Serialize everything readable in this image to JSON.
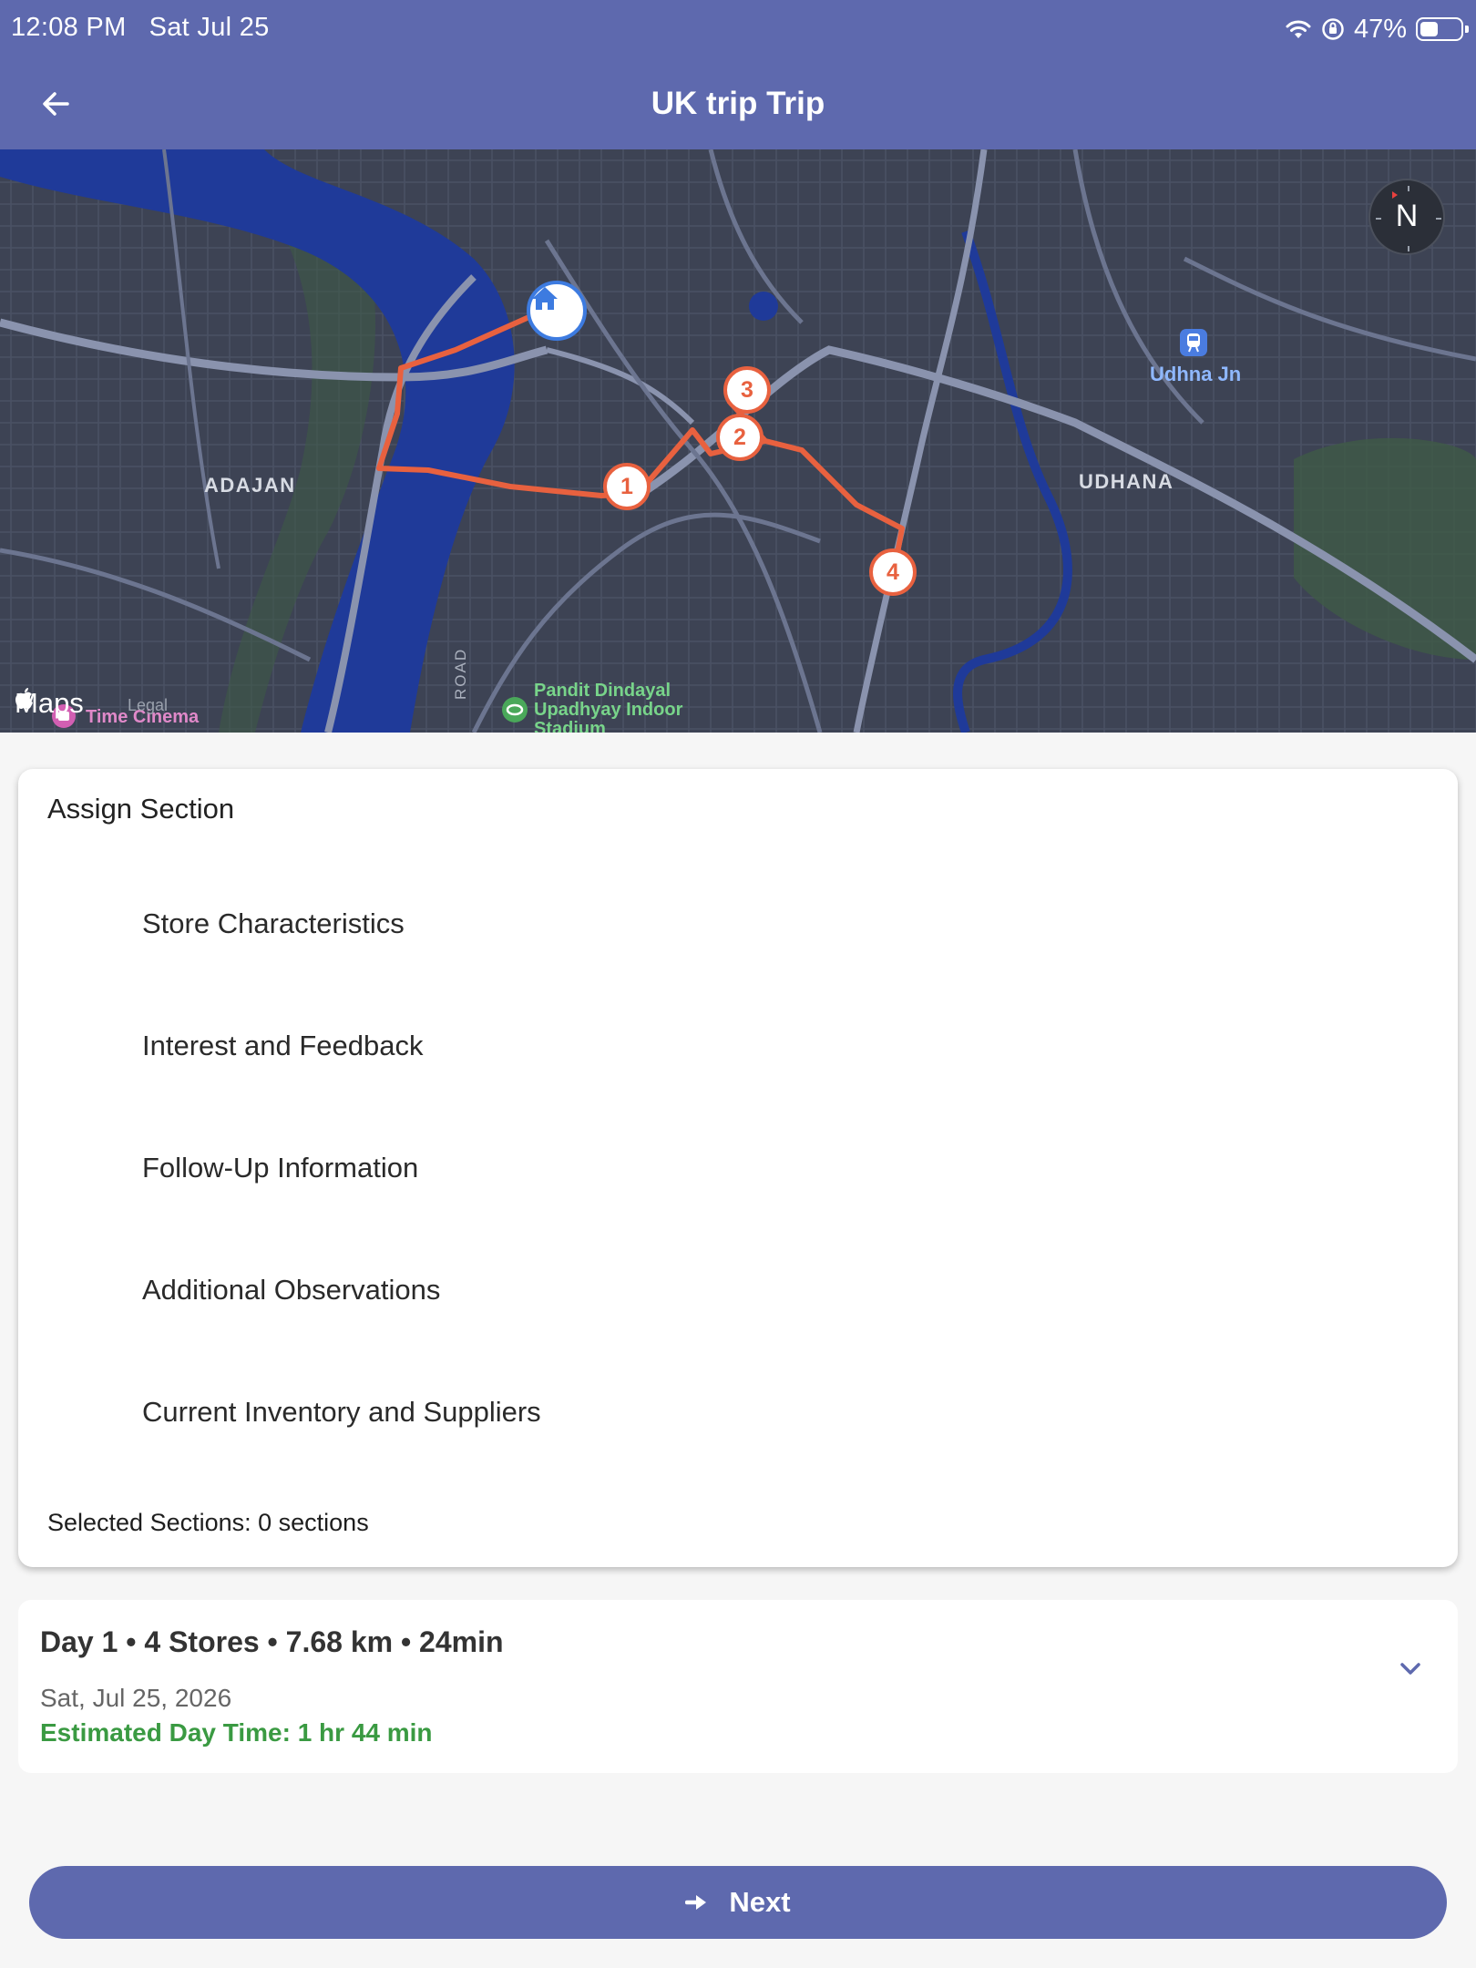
{
  "status_bar": {
    "time": "12:08 PM",
    "date": "Sat Jul 25",
    "battery": "47%",
    "battery_level": 0.47
  },
  "header": {
    "title": "UK trip Trip",
    "back_icon": "arrow-left-icon"
  },
  "map": {
    "areas": [
      "ADAJAN",
      "UDHANA"
    ],
    "station": "Udhna Jn",
    "poi": [
      "Pandit Dindayal",
      "Upadhyay Indoor",
      "Stadium"
    ],
    "cinema": "Time Cinema",
    "road_label": "ROAD",
    "attribution": "Maps",
    "legal": "Legal",
    "compass": "N",
    "stops": [
      "1",
      "2",
      "3",
      "4"
    ],
    "colors": {
      "route": "#e8613f",
      "home": "#3d7be0",
      "water": "#1f3a99"
    }
  },
  "assign_section": {
    "title": "Assign Section",
    "items": [
      "Store Characteristics",
      "Interest and Feedback",
      "Follow-Up Information",
      "Additional Observations",
      "Current Inventory and Suppliers"
    ],
    "selected_text": "Selected Sections: 0 sections"
  },
  "day": {
    "summary": "Day 1 • 4 Stores • 7.68 km • 24min",
    "date": "Sat, Jul 25, 2026",
    "estimate": "Estimated Day Time: 1 hr 44 min",
    "estimate_color": "#3a9a42"
  },
  "next_button": {
    "label": "Next",
    "icon": "arrow-right-icon",
    "color": "#5e69ae"
  }
}
